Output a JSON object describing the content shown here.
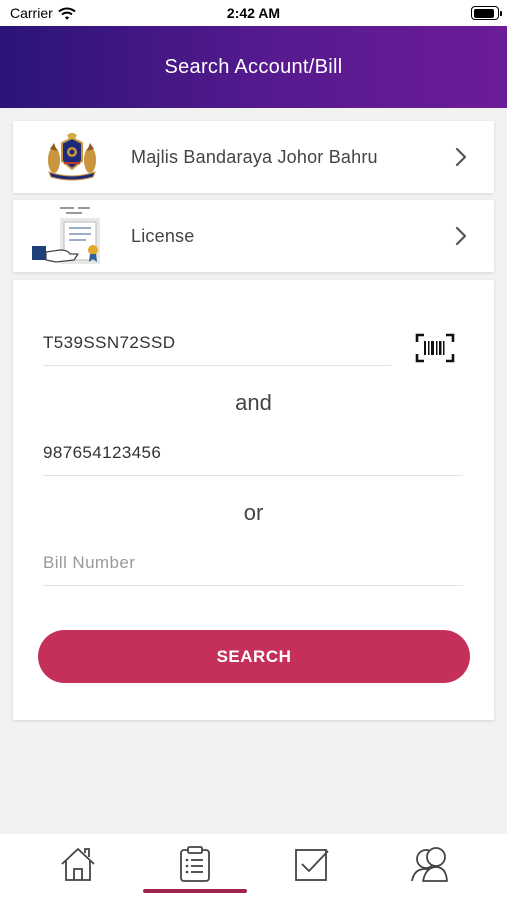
{
  "status_bar": {
    "carrier": "Carrier",
    "time": "2:42 AM",
    "battery_level": 0.95
  },
  "header": {
    "title": "Search Account/Bill"
  },
  "council": {
    "name": "Majlis Bandaraya Johor Bahru",
    "icon": "council-crest-icon"
  },
  "category": {
    "name": "License",
    "icon": "license-certificate-icon"
  },
  "form": {
    "account_value": "T539SSN72SSD",
    "connector_and": "and",
    "ic_value": "987654123456",
    "connector_or": "or",
    "bill_placeholder": "Bill Number",
    "search_label": "SEARCH"
  },
  "tabs": [
    {
      "name": "home",
      "icon": "home-icon",
      "active": false
    },
    {
      "name": "bills",
      "icon": "clipboard-list-icon",
      "active": true
    },
    {
      "name": "checklist",
      "icon": "checkbox-icon",
      "active": false
    },
    {
      "name": "profile",
      "icon": "users-icon",
      "active": false
    }
  ],
  "colors": {
    "header_start": "#2b1477",
    "header_end": "#6c1c98",
    "accent": "#c4305a",
    "tab_indicator": "#a0244e"
  }
}
